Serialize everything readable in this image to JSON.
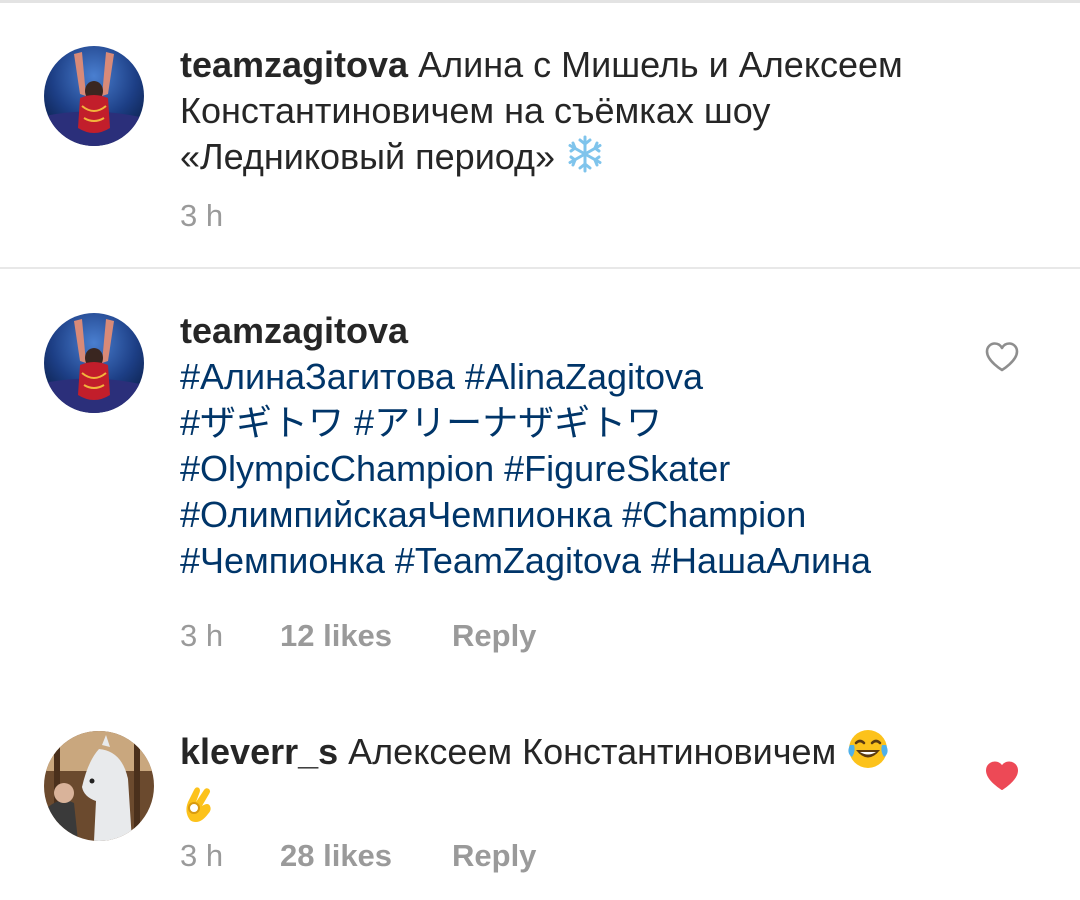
{
  "caption": {
    "username": "teamzagitova",
    "text_line1": " Алина с Мишель и Алексеем",
    "text_line2": "Константиновичем на съёмках шоу",
    "text_line3": "«Ледниковый период» ",
    "emoji_icon": "snowflake-icon",
    "time": "3 h"
  },
  "comments": [
    {
      "username": "teamzagitova",
      "hashtag_lines": [
        [
          "#АлинаЗагитова",
          "#AlinaZagitova"
        ],
        [
          "#ザギトワ",
          "#アリーナザギトワ"
        ],
        [
          "#OlympicChampion",
          "#FigureSkater"
        ],
        [
          "#ОлимпийскаяЧемпионка",
          "#Champion"
        ],
        [
          "#Чемпионка",
          "#TeamZagitova",
          "#НашаАлина"
        ]
      ],
      "time": "3 h",
      "likes": "12 likes",
      "reply": "Reply",
      "liked": false,
      "like_icon": "heart-outline-icon"
    },
    {
      "username": "kleverr_s",
      "text": " Алексеем Константиновичем ",
      "emoji_icons": [
        "tears-of-joy-emoji-icon",
        "ok-hand-emoji-icon"
      ],
      "time": "3 h",
      "likes": "28 likes",
      "reply": "Reply",
      "liked": true,
      "like_icon": "heart-filled-icon",
      "like_color": "#ed4956"
    }
  ],
  "colors": {
    "hashtag": "#003569",
    "meta": "#9a9a9a",
    "text": "#262626",
    "liked_heart": "#ed4956"
  }
}
